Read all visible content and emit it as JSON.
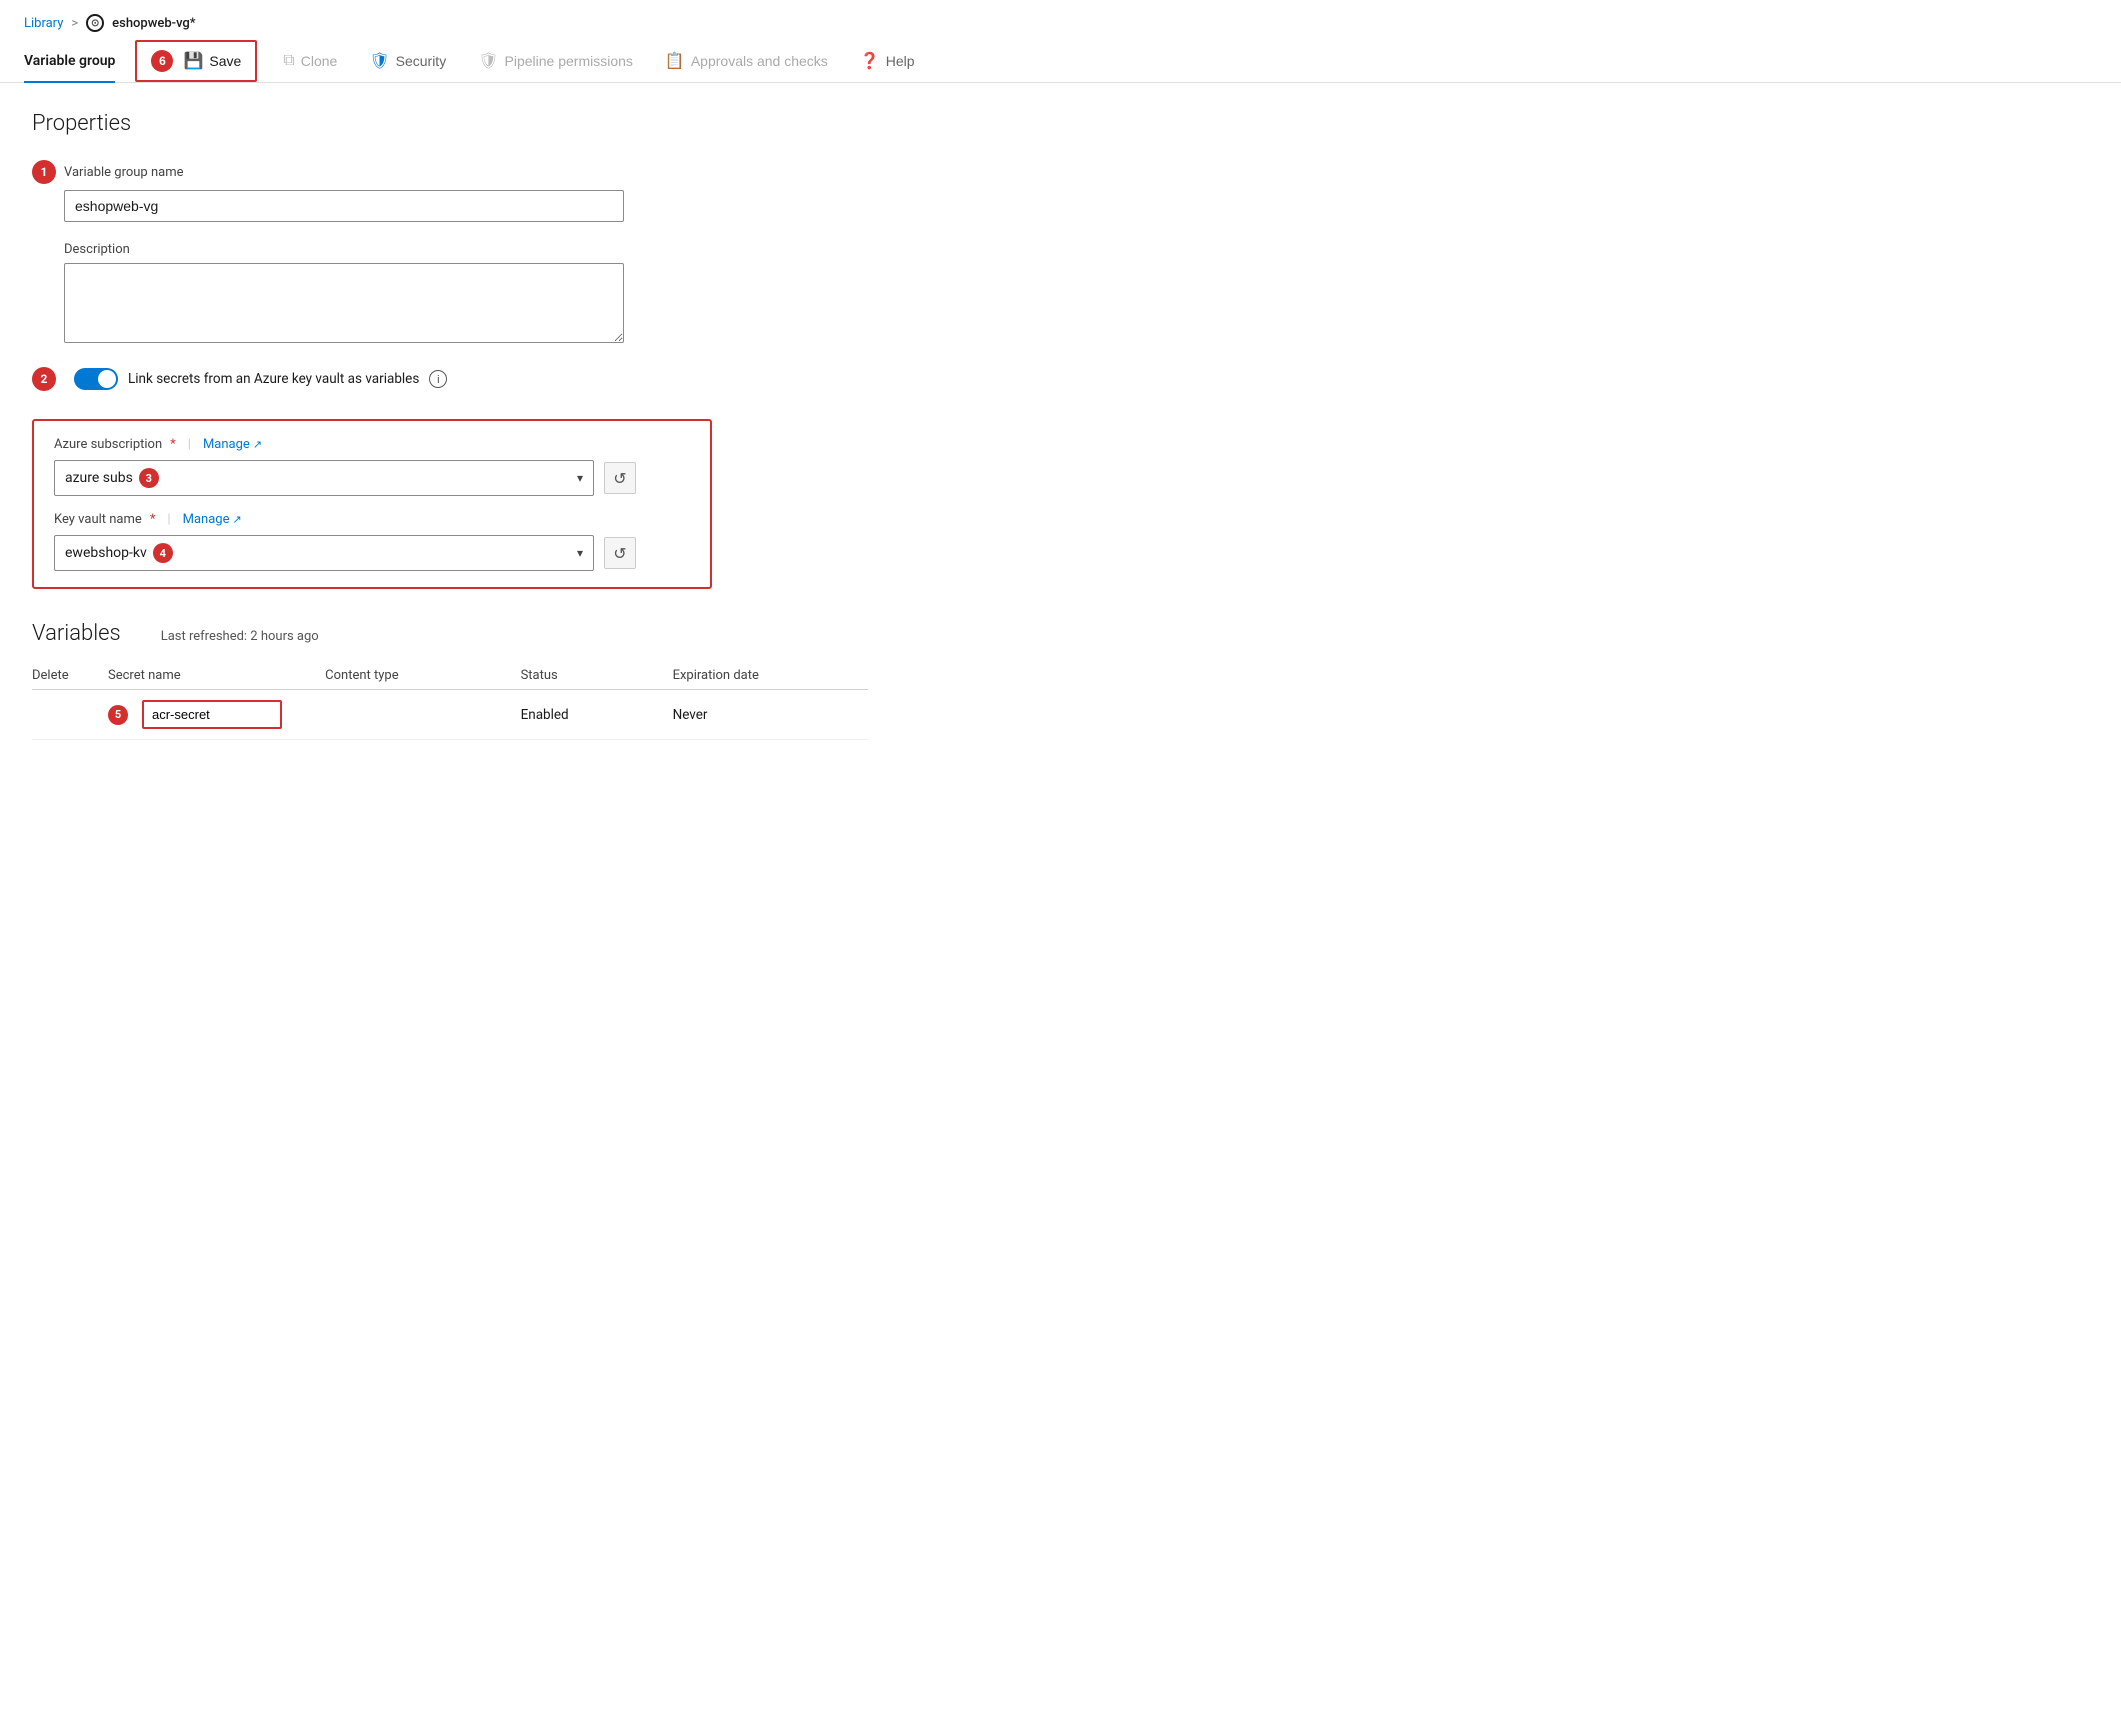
{
  "breadcrumb": {
    "library_label": "Library",
    "separator": ">",
    "current_page": "eshopweb-vg*"
  },
  "toolbar": {
    "tab_label": "Variable group",
    "save_label": "Save",
    "clone_label": "Clone",
    "security_label": "Security",
    "pipeline_permissions_label": "Pipeline permissions",
    "approvals_label": "Approvals and checks",
    "help_label": "Help",
    "save_badge": "6"
  },
  "properties": {
    "section_title": "Properties",
    "variable_group_name_label": "Variable group name",
    "variable_group_name_value": "eshopweb-vg",
    "description_label": "Description",
    "description_placeholder": "",
    "step1_badge": "1",
    "step2_badge": "2",
    "toggle_label": "Link secrets from an Azure key vault as variables",
    "toggle_on": true
  },
  "keyvault": {
    "azure_subscription_label": "Azure subscription",
    "required_marker": "*",
    "manage_label": "Manage",
    "azure_subscription_value": "azure subs",
    "step3_badge": "3",
    "key_vault_name_label": "Key vault name",
    "key_vault_name_value": "ewebshop-kv",
    "step4_badge": "4"
  },
  "variables": {
    "section_title": "Variables",
    "last_refreshed": "Last refreshed: 2 hours ago",
    "columns": {
      "delete": "Delete",
      "secret_name": "Secret name",
      "content_type": "Content type",
      "status": "Status",
      "expiration_date": "Expiration date"
    },
    "rows": [
      {
        "delete": "",
        "secret_name": "acr-secret",
        "content_type": "",
        "status": "Enabled",
        "expiration_date": "Never"
      }
    ],
    "step5_badge": "5"
  }
}
